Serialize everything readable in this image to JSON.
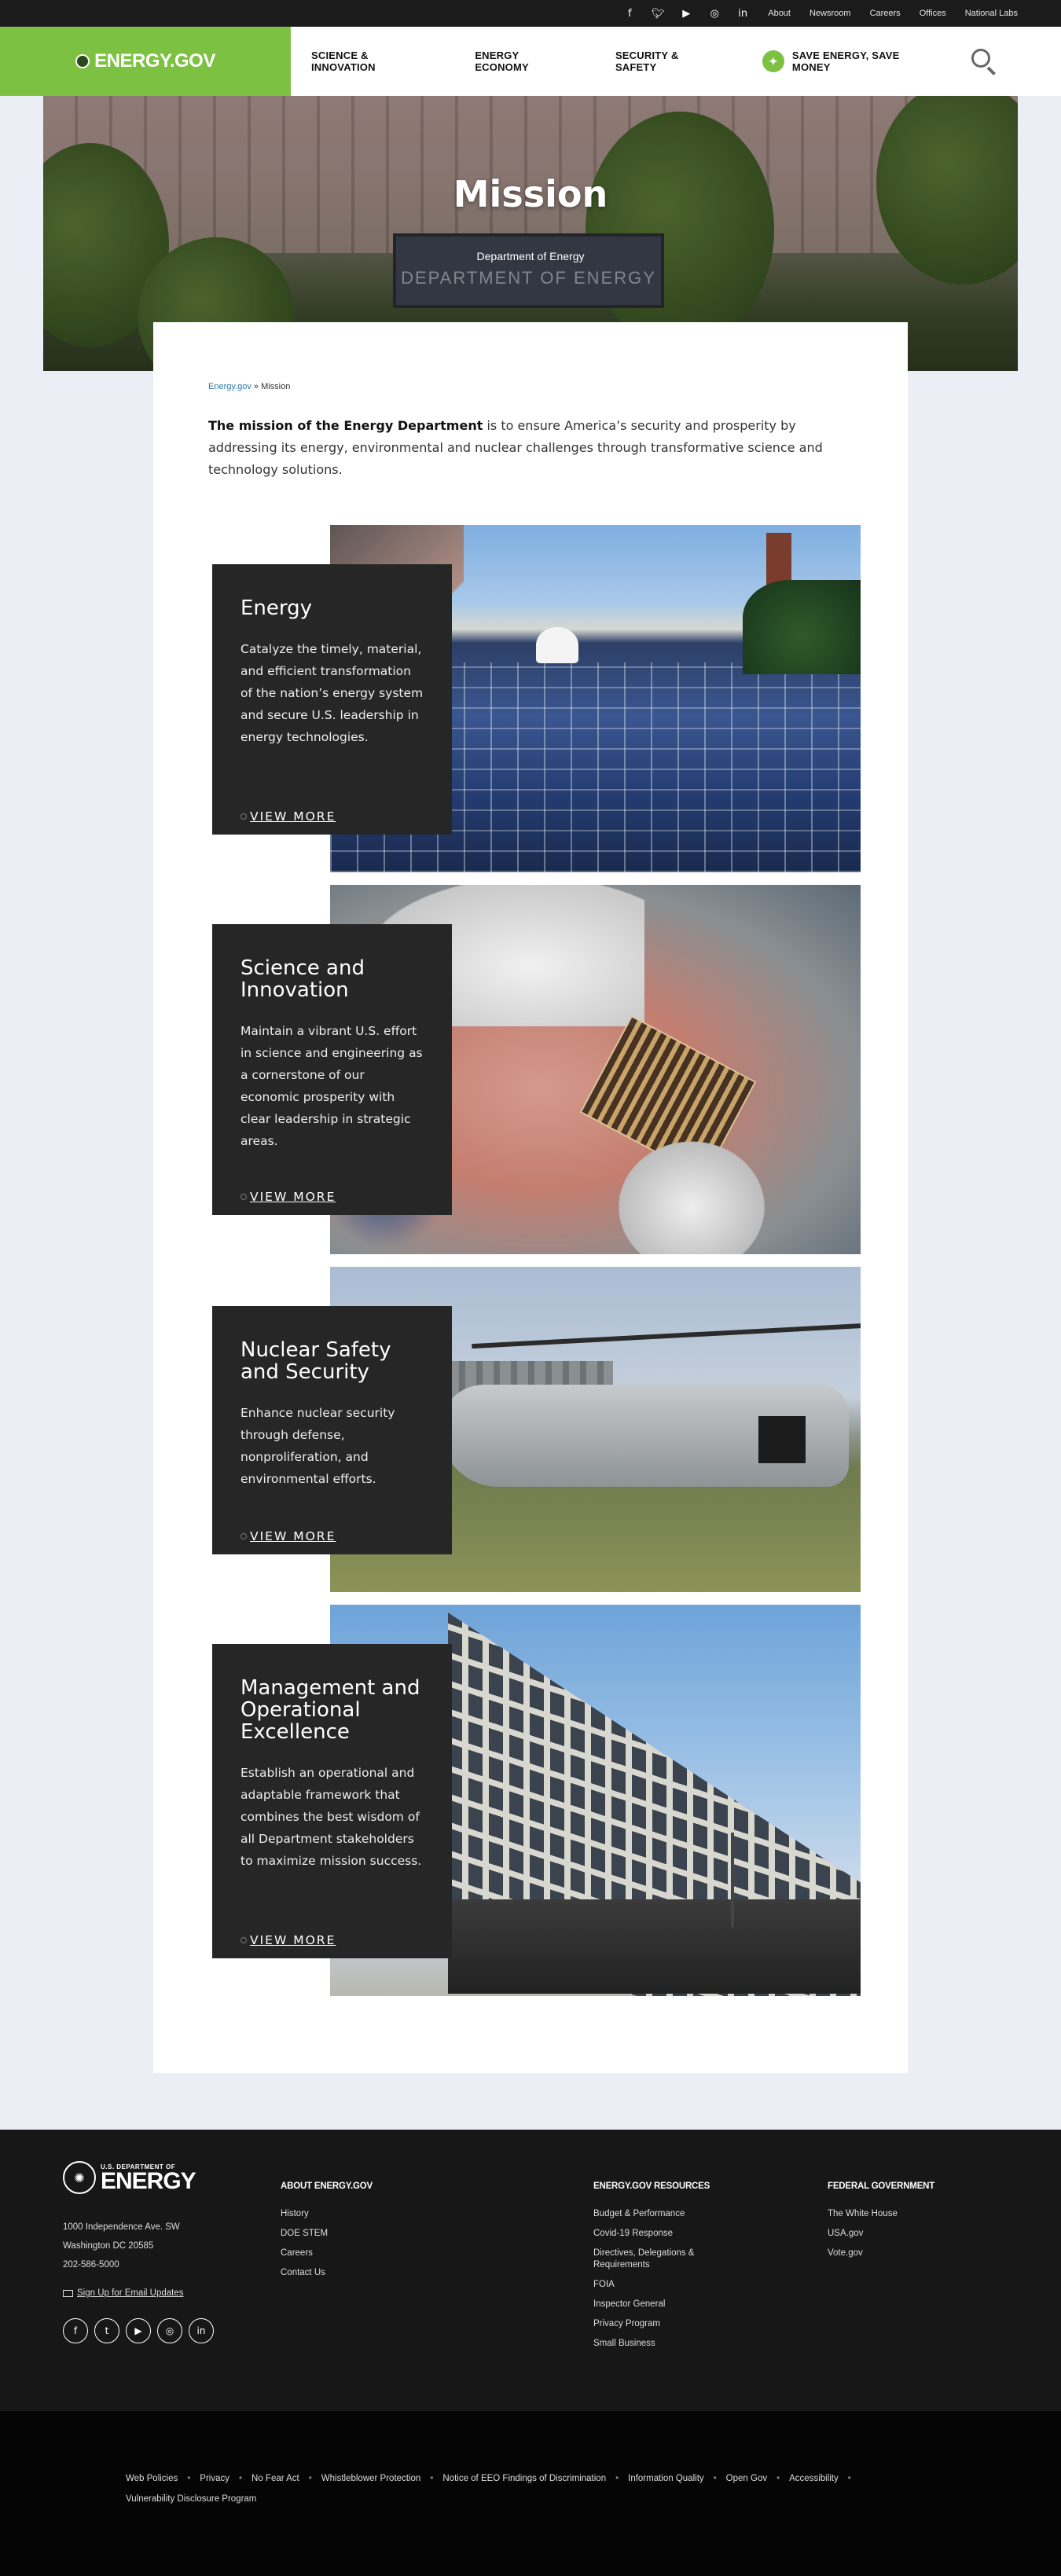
{
  "utility": {
    "social": [
      "facebook-icon",
      "twitter-icon",
      "youtube-icon",
      "instagram-icon",
      "linkedin-icon"
    ],
    "links": [
      "About",
      "Newsroom",
      "Careers",
      "Offices",
      "National Labs"
    ]
  },
  "header": {
    "logo": "ENERGY.GOV",
    "nav": [
      "SCIENCE & INNOVATION",
      "ENERGY ECONOMY",
      "SECURITY & SAFETY"
    ],
    "save": "SAVE ENERGY, SAVE MONEY",
    "brand_color": "#7dc142"
  },
  "hero": {
    "title": "Mission",
    "subtitle": "Department of Energy",
    "sign_text": "DEPARTMENT OF ENERGY"
  },
  "breadcrumb": {
    "home": "Energy.gov",
    "sep": "»",
    "current": "Mission"
  },
  "intro": {
    "bold": "The mission of the Energy Department",
    "rest": " is to ensure America’s security and prosperity by addressing its energy, environmental and nuclear challenges through transformative science and technology solutions."
  },
  "blocks": [
    {
      "title": "Energy",
      "text": "Catalyze the timely, material, and efficient transformation of the nation’s energy system and secure U.S. leadership in energy technologies.",
      "more": "VIEW MORE"
    },
    {
      "title": "Science and Innovation",
      "text": "Maintain a vibrant U.S. effort in science and engineering as a cornerstone of our economic prosperity with clear leadership in strategic areas.",
      "more": "VIEW MORE"
    },
    {
      "title": "Nuclear Safety and Security",
      "text": "Enhance nuclear security through defense, nonproliferation, and environmental efforts.",
      "more": "VIEW MORE"
    },
    {
      "title": "Management and Operational Excellence",
      "text": "Establish an operational and adaptable framework that combines the best wisdom of all Department stakeholders to maximize mission success.",
      "more": "VIEW MORE"
    }
  ],
  "footer": {
    "logo_small": "U.S. DEPARTMENT OF",
    "logo_big": "ENERGY",
    "address1": "1000 Independence Ave. SW",
    "address2": "Washington DC 20585",
    "phone": "202-586-5000",
    "email": "Sign Up for Email Updates",
    "col1": {
      "title": "ABOUT ENERGY.GOV",
      "links": [
        "History",
        "DOE STEM",
        "Careers",
        "Contact Us"
      ]
    },
    "col2": {
      "title": "ENERGY.GOV RESOURCES",
      "links": [
        "Budget & Performance",
        "Covid-19 Response",
        "Directives, Delegations & Requirements",
        "FOIA",
        "Inspector General",
        "Privacy Program",
        "Small Business"
      ]
    },
    "col3": {
      "title": "FEDERAL GOVERNMENT",
      "links": [
        "The White House",
        "USA.gov",
        "Vote.gov"
      ]
    }
  },
  "subfooter": {
    "links": [
      "Web Policies",
      "Privacy",
      "No Fear Act",
      "Whistleblower Protection",
      "Notice of EEO Findings of Discrimination",
      "Information Quality",
      "Open Gov",
      "Accessibility",
      "Vulnerability Disclosure Program"
    ]
  }
}
